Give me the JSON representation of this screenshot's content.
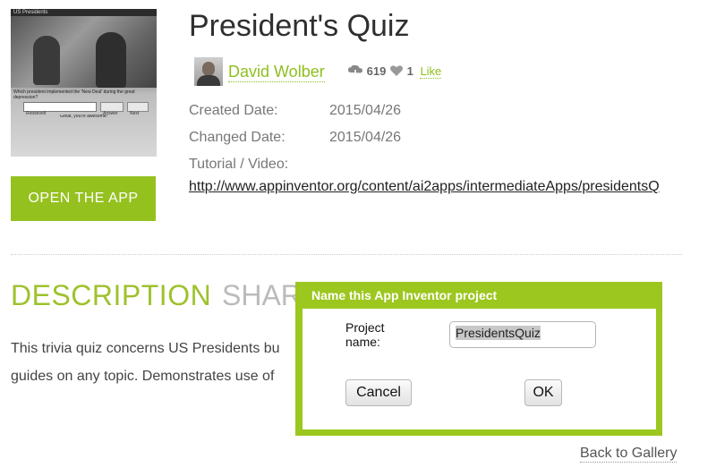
{
  "app": {
    "title": "President's Quiz",
    "thumbnail_caption": "US Presidents",
    "thumbnail_question": "Which president implemented the 'New Deal' during the great depression?",
    "thumbnail_answer_placeholder": "Roosevelt",
    "thumbnail_answer_button": "Answer",
    "thumbnail_next_button": "Next",
    "thumbnail_feedback": "Great, you're awesome!",
    "open_button": "OPEN THE APP"
  },
  "author": {
    "name": "David Wolber",
    "downloads": "619",
    "likes": "1",
    "like_label": "Like"
  },
  "meta": {
    "created_label": "Created Date:",
    "created_value": "2015/04/26",
    "changed_label": "Changed Date:",
    "changed_value": "2015/04/26",
    "tutorial_label": "Tutorial / Video:",
    "tutorial_link": "http://www.appinventor.org/content/ai2apps/intermediateApps/presidentsQ"
  },
  "tabs": {
    "description": "DESCRIPTION",
    "share": "SHAR"
  },
  "description": {
    "line1": "This trivia quiz concerns US Presidents bu",
    "line2": "guides on any topic. Demonstrates use of"
  },
  "footer": {
    "back_label": "Back to Gallery"
  },
  "dialog": {
    "title": "Name this App Inventor project",
    "project_label": "Project name:",
    "project_value": "PresidentsQuiz",
    "cancel_label": "Cancel",
    "ok_label": "OK"
  },
  "colors": {
    "accent": "#95c11f",
    "link_green": "#8fbf20"
  },
  "icons": [
    "download-icon",
    "heart-icon"
  ]
}
